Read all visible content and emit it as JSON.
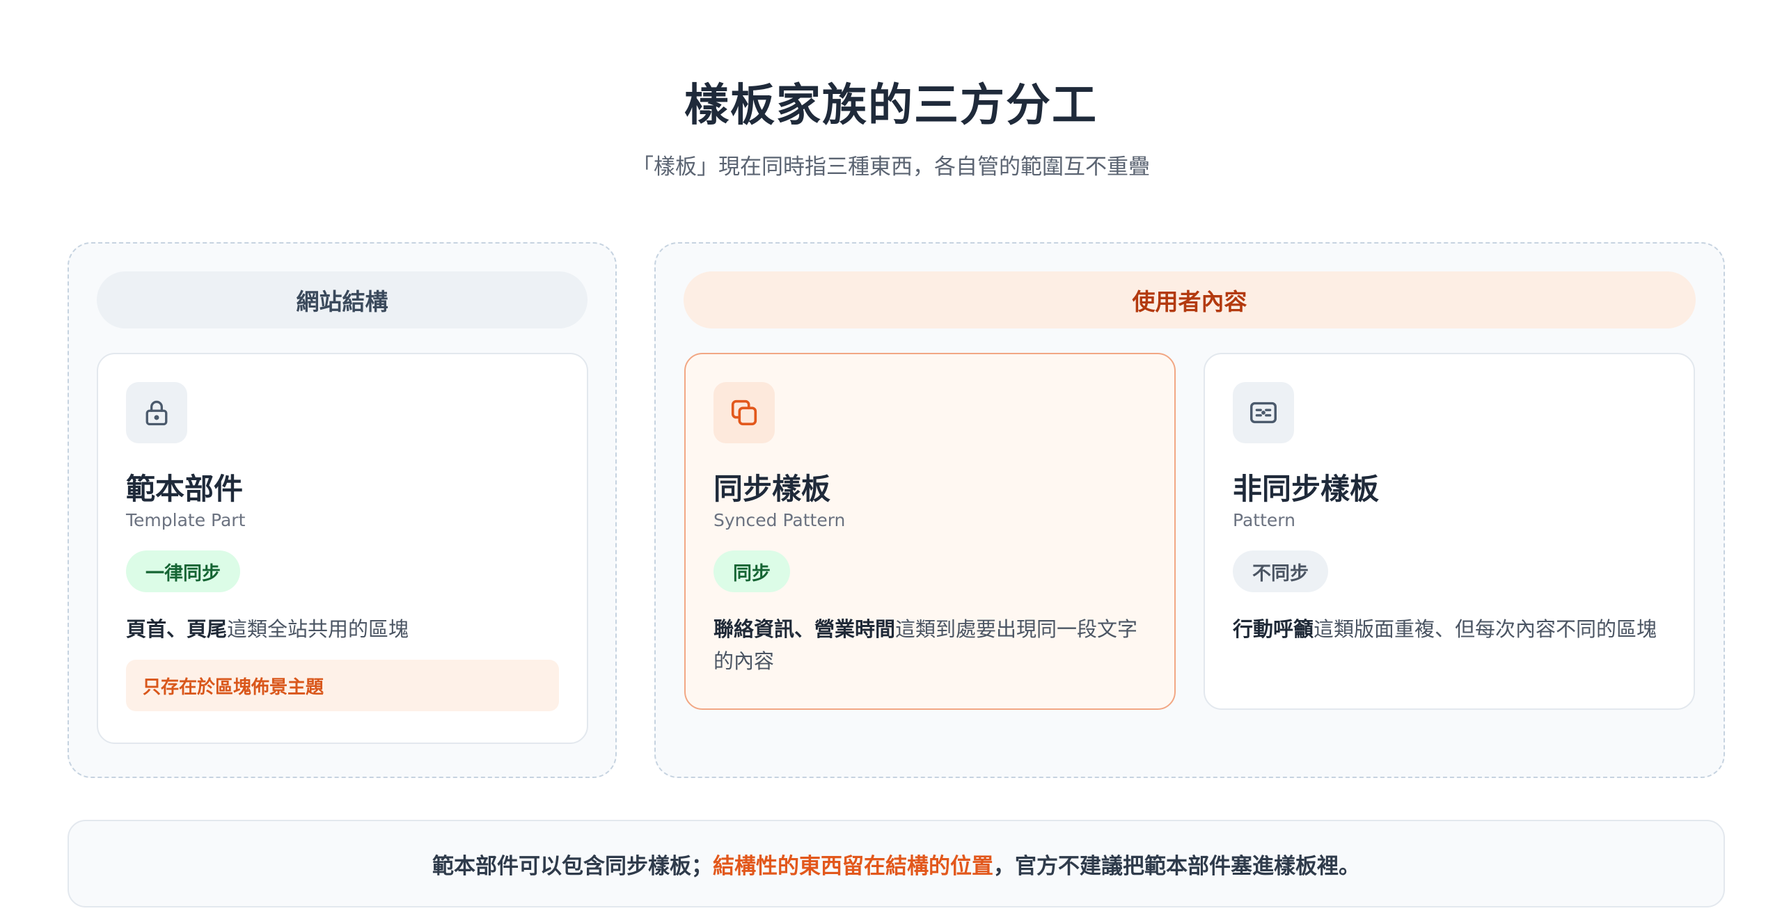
{
  "header": {
    "title": "樣板家族的三方分工",
    "subtitle": "「樣板」現在同時指三種東西，各自管的範圍互不重疊"
  },
  "groups": {
    "site": {
      "label": "網站結構"
    },
    "user": {
      "label": "使用者內容"
    }
  },
  "cards": {
    "template_part": {
      "icon": "lock-icon",
      "title": "範本部件",
      "subtitle": "Template Part",
      "badge": "一律同步",
      "desc_bold": "頁首、頁尾",
      "desc_rest": "這類全站共用的區塊",
      "note": "只存在於區塊佈景主題"
    },
    "synced_pattern": {
      "icon": "copy-icon",
      "title": "同步樣板",
      "subtitle": "Synced Pattern",
      "badge": "同步",
      "desc_bold": "聯絡資訊、營業時間",
      "desc_rest": "這類到處要出現同一段文字的內容"
    },
    "pattern": {
      "icon": "layout-card-icon",
      "title": "非同步樣板",
      "subtitle": "Pattern",
      "badge": "不同步",
      "desc_bold": "行動呼籲",
      "desc_rest": "這類版面重複、但每次內容不同的區塊"
    }
  },
  "footer": {
    "part1": "範本部件可以包含同步樣板；",
    "highlight": "結構性的東西留在結構的位置",
    "part2": "，官方不建議把範本部件塞進樣板裡。"
  },
  "colors": {
    "accent": "#e2581c",
    "green_badge_bg": "#dcfce7",
    "green_badge_text": "#166534",
    "user_header_bg": "#fdeee4"
  }
}
